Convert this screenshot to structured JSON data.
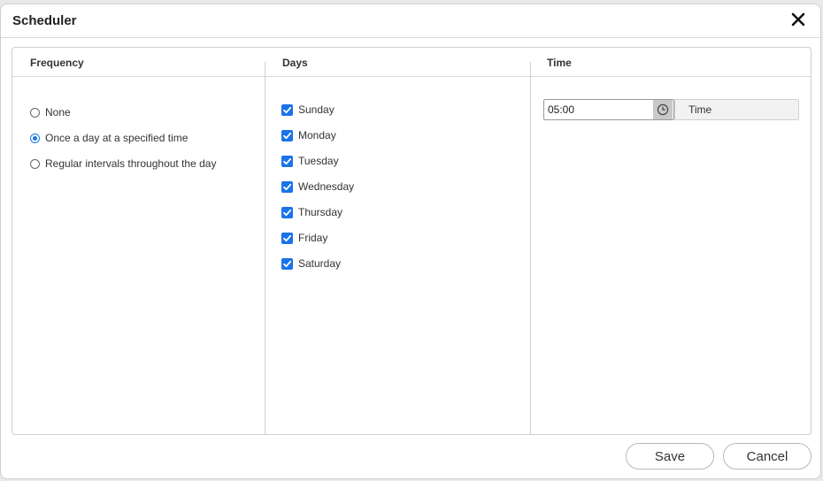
{
  "dialog": {
    "title": "Scheduler"
  },
  "columns": {
    "frequency": "Frequency",
    "days": "Days",
    "time": "Time"
  },
  "frequency": {
    "selected": "Once a day at a specified time",
    "options": [
      "None",
      "Once a day at a specified time",
      "Regular intervals throughout the day"
    ]
  },
  "days": {
    "checked": [
      true,
      true,
      true,
      true,
      true,
      true,
      true
    ],
    "items": [
      "Sunday",
      "Monday",
      "Tuesday",
      "Wednesday",
      "Thursday",
      "Friday",
      "Saturday"
    ]
  },
  "time": {
    "value": "05:00",
    "button_label": "Time"
  },
  "footer": {
    "save_label": "Save",
    "cancel_label": "Cancel"
  },
  "colors": {
    "accent": "#1a73e8",
    "border": "#cfcfcf"
  },
  "icons": {
    "close": "close-icon",
    "clock": "clock-icon",
    "check": "check-icon"
  }
}
